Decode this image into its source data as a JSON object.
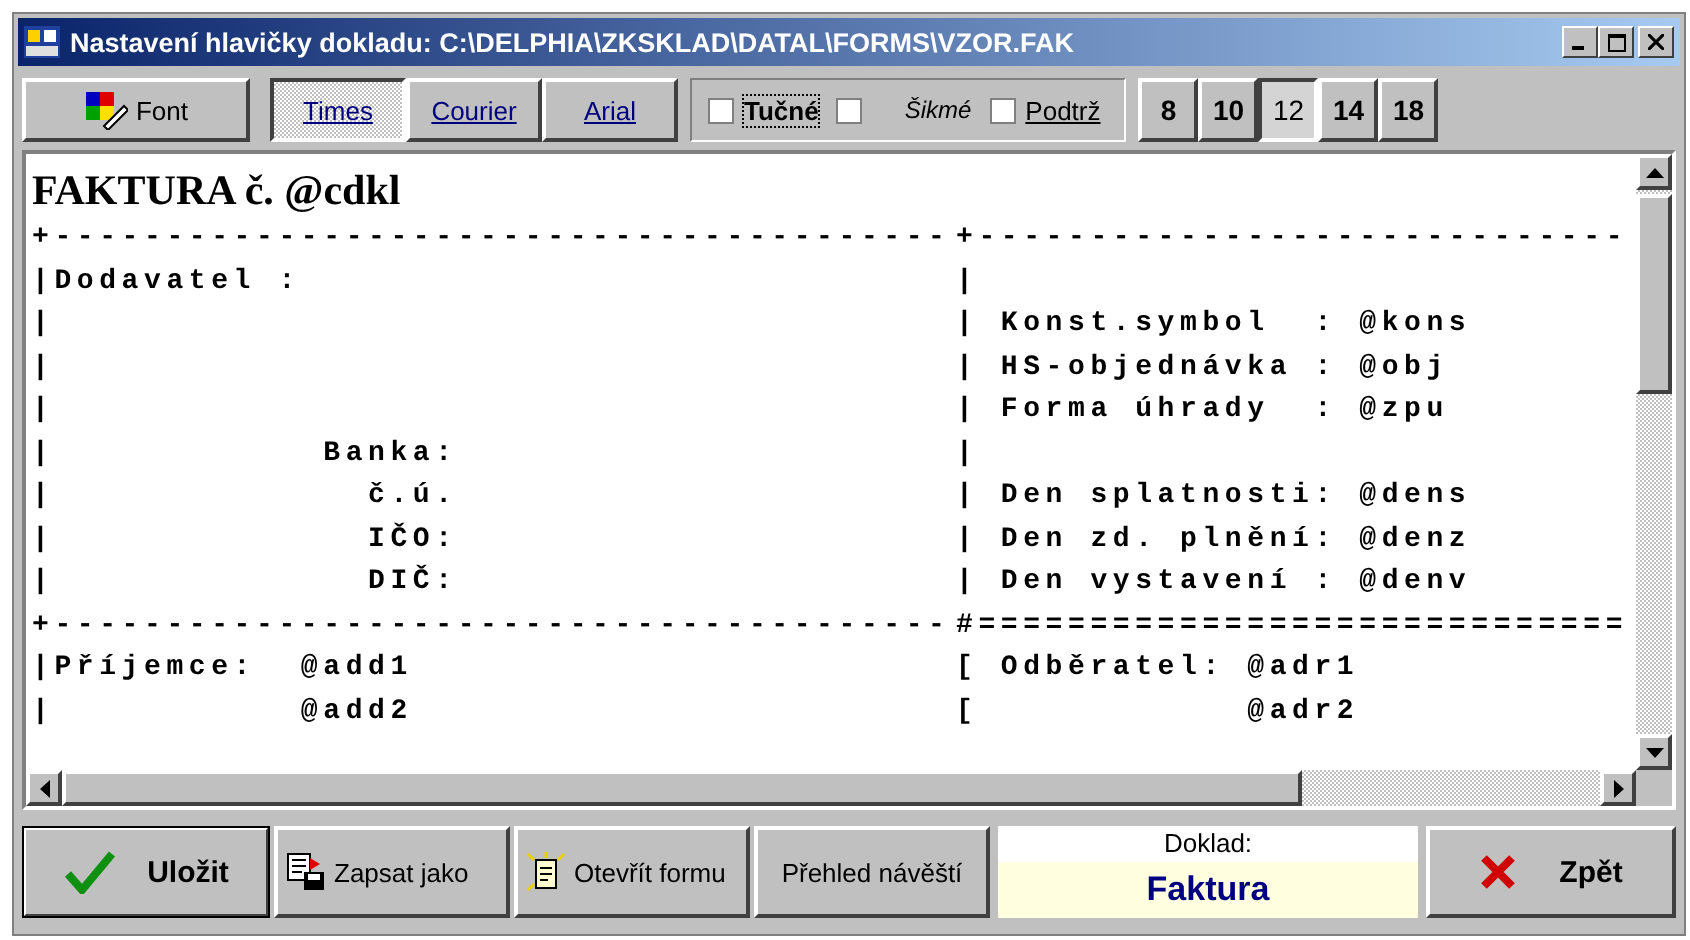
{
  "window": {
    "title": "Nastavení hlavičky dokladu: C:\\DELPHIA\\ZKSKLAD\\DATAL\\FORMS\\VZOR.FAK"
  },
  "toolbar": {
    "font_button": "Font",
    "fonts": [
      {
        "label": "Times",
        "selected": true
      },
      {
        "label": "Courier",
        "selected": false
      },
      {
        "label": "Arial",
        "selected": false
      }
    ],
    "styles": [
      {
        "label": "Tučné",
        "kind": "bold",
        "checked": false
      },
      {
        "label": "Šikmé",
        "kind": "italic",
        "checked": false
      },
      {
        "label": "Podtrž",
        "kind": "underline",
        "checked": false
      }
    ],
    "sizes": [
      {
        "label": "8",
        "selected": false
      },
      {
        "label": "10",
        "selected": false
      },
      {
        "label": "12",
        "selected": true
      },
      {
        "label": "14",
        "selected": false
      },
      {
        "label": "18",
        "selected": false
      }
    ]
  },
  "editor": {
    "heading": "FAKTURA č. @cdkl",
    "lines": [
      {
        "left": "+----------------------------------------",
        "right": "+-----------------------------"
      },
      {
        "left": "|Dodavatel :",
        "right": "|"
      },
      {
        "left": "|",
        "right": "| Konst.symbol  : @kons"
      },
      {
        "left": "|",
        "right": "| HS-objednávka : @obj"
      },
      {
        "left": "|",
        "right": "| Forma úhrady  : @zpu"
      },
      {
        "left": "|            Banka:",
        "right": "|"
      },
      {
        "left": "|              č.ú.",
        "right": "| Den splatnosti: @dens"
      },
      {
        "left": "|              IČO:",
        "right": "| Den zd. plnění: @denz"
      },
      {
        "left": "|              DIČ:",
        "right": "| Den vystavení : @denv"
      },
      {
        "left": "+----------------------------------------",
        "right": "#============================="
      },
      {
        "left": "|Příjemce:  @add1",
        "right": "[ Odběratel: @adr1"
      },
      {
        "left": "|           @add2",
        "right": "[            @adr2"
      }
    ]
  },
  "footer": {
    "buttons": [
      {
        "label": "Uložit",
        "kind": "save"
      },
      {
        "label": "Zapsat jako",
        "kind": "saveas"
      },
      {
        "label": "Otevřít formu",
        "kind": "open"
      },
      {
        "label": "Přehled návěští",
        "kind": "plain"
      }
    ],
    "doklad_label": "Doklad:",
    "doklad_value": "Faktura",
    "back_button": "Zpět"
  }
}
